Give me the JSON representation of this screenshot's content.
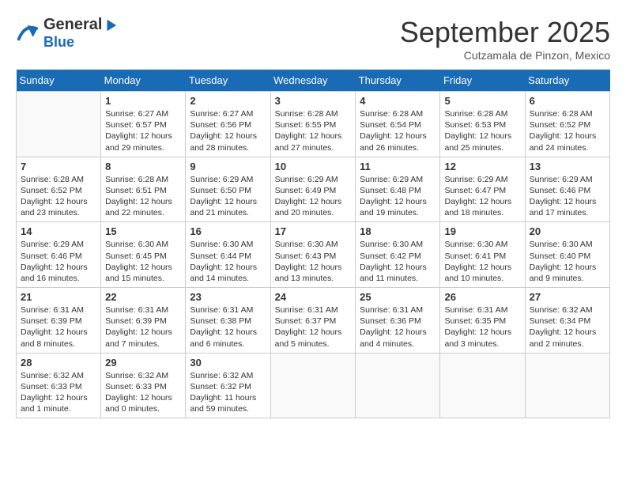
{
  "header": {
    "logo_line1": "General",
    "logo_line2": "Blue",
    "month": "September 2025",
    "location": "Cutzamala de Pinzon, Mexico"
  },
  "days_of_week": [
    "Sunday",
    "Monday",
    "Tuesday",
    "Wednesday",
    "Thursday",
    "Friday",
    "Saturday"
  ],
  "weeks": [
    [
      {
        "day": "",
        "info": ""
      },
      {
        "day": "1",
        "info": "Sunrise: 6:27 AM\nSunset: 6:57 PM\nDaylight: 12 hours\nand 29 minutes."
      },
      {
        "day": "2",
        "info": "Sunrise: 6:27 AM\nSunset: 6:56 PM\nDaylight: 12 hours\nand 28 minutes."
      },
      {
        "day": "3",
        "info": "Sunrise: 6:28 AM\nSunset: 6:55 PM\nDaylight: 12 hours\nand 27 minutes."
      },
      {
        "day": "4",
        "info": "Sunrise: 6:28 AM\nSunset: 6:54 PM\nDaylight: 12 hours\nand 26 minutes."
      },
      {
        "day": "5",
        "info": "Sunrise: 6:28 AM\nSunset: 6:53 PM\nDaylight: 12 hours\nand 25 minutes."
      },
      {
        "day": "6",
        "info": "Sunrise: 6:28 AM\nSunset: 6:52 PM\nDaylight: 12 hours\nand 24 minutes."
      }
    ],
    [
      {
        "day": "7",
        "info": "Sunrise: 6:28 AM\nSunset: 6:52 PM\nDaylight: 12 hours\nand 23 minutes."
      },
      {
        "day": "8",
        "info": "Sunrise: 6:28 AM\nSunset: 6:51 PM\nDaylight: 12 hours\nand 22 minutes."
      },
      {
        "day": "9",
        "info": "Sunrise: 6:29 AM\nSunset: 6:50 PM\nDaylight: 12 hours\nand 21 minutes."
      },
      {
        "day": "10",
        "info": "Sunrise: 6:29 AM\nSunset: 6:49 PM\nDaylight: 12 hours\nand 20 minutes."
      },
      {
        "day": "11",
        "info": "Sunrise: 6:29 AM\nSunset: 6:48 PM\nDaylight: 12 hours\nand 19 minutes."
      },
      {
        "day": "12",
        "info": "Sunrise: 6:29 AM\nSunset: 6:47 PM\nDaylight: 12 hours\nand 18 minutes."
      },
      {
        "day": "13",
        "info": "Sunrise: 6:29 AM\nSunset: 6:46 PM\nDaylight: 12 hours\nand 17 minutes."
      }
    ],
    [
      {
        "day": "14",
        "info": "Sunrise: 6:29 AM\nSunset: 6:46 PM\nDaylight: 12 hours\nand 16 minutes."
      },
      {
        "day": "15",
        "info": "Sunrise: 6:30 AM\nSunset: 6:45 PM\nDaylight: 12 hours\nand 15 minutes."
      },
      {
        "day": "16",
        "info": "Sunrise: 6:30 AM\nSunset: 6:44 PM\nDaylight: 12 hours\nand 14 minutes."
      },
      {
        "day": "17",
        "info": "Sunrise: 6:30 AM\nSunset: 6:43 PM\nDaylight: 12 hours\nand 13 minutes."
      },
      {
        "day": "18",
        "info": "Sunrise: 6:30 AM\nSunset: 6:42 PM\nDaylight: 12 hours\nand 11 minutes."
      },
      {
        "day": "19",
        "info": "Sunrise: 6:30 AM\nSunset: 6:41 PM\nDaylight: 12 hours\nand 10 minutes."
      },
      {
        "day": "20",
        "info": "Sunrise: 6:30 AM\nSunset: 6:40 PM\nDaylight: 12 hours\nand 9 minutes."
      }
    ],
    [
      {
        "day": "21",
        "info": "Sunrise: 6:31 AM\nSunset: 6:39 PM\nDaylight: 12 hours\nand 8 minutes."
      },
      {
        "day": "22",
        "info": "Sunrise: 6:31 AM\nSunset: 6:39 PM\nDaylight: 12 hours\nand 7 minutes."
      },
      {
        "day": "23",
        "info": "Sunrise: 6:31 AM\nSunset: 6:38 PM\nDaylight: 12 hours\nand 6 minutes."
      },
      {
        "day": "24",
        "info": "Sunrise: 6:31 AM\nSunset: 6:37 PM\nDaylight: 12 hours\nand 5 minutes."
      },
      {
        "day": "25",
        "info": "Sunrise: 6:31 AM\nSunset: 6:36 PM\nDaylight: 12 hours\nand 4 minutes."
      },
      {
        "day": "26",
        "info": "Sunrise: 6:31 AM\nSunset: 6:35 PM\nDaylight: 12 hours\nand 3 minutes."
      },
      {
        "day": "27",
        "info": "Sunrise: 6:32 AM\nSunset: 6:34 PM\nDaylight: 12 hours\nand 2 minutes."
      }
    ],
    [
      {
        "day": "28",
        "info": "Sunrise: 6:32 AM\nSunset: 6:33 PM\nDaylight: 12 hours\nand 1 minute."
      },
      {
        "day": "29",
        "info": "Sunrise: 6:32 AM\nSunset: 6:33 PM\nDaylight: 12 hours\nand 0 minutes."
      },
      {
        "day": "30",
        "info": "Sunrise: 6:32 AM\nSunset: 6:32 PM\nDaylight: 11 hours\nand 59 minutes."
      },
      {
        "day": "",
        "info": ""
      },
      {
        "day": "",
        "info": ""
      },
      {
        "day": "",
        "info": ""
      },
      {
        "day": "",
        "info": ""
      }
    ]
  ]
}
